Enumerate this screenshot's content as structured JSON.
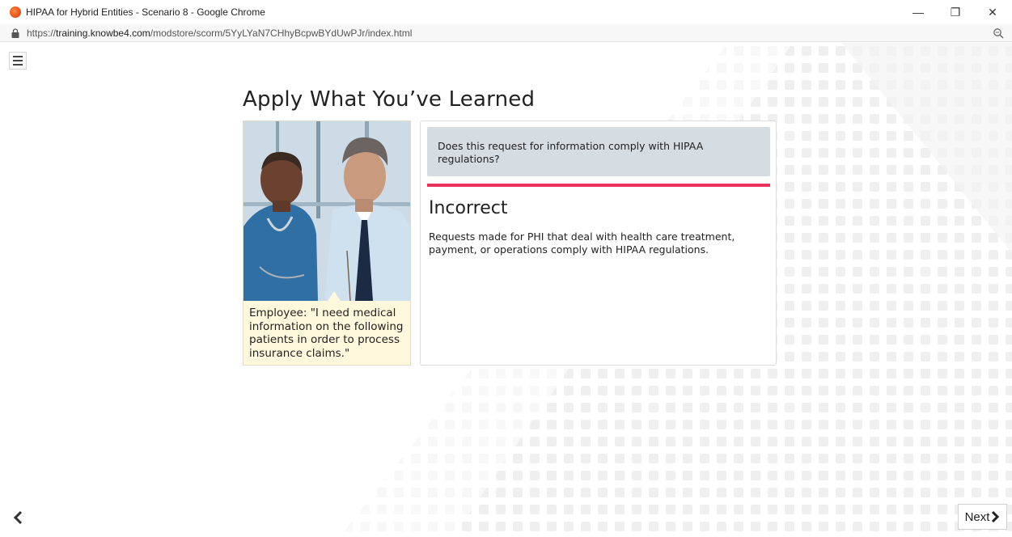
{
  "window": {
    "title": "HIPAA for Hybrid Entities - Scenario 8 - Google Chrome",
    "controls": {
      "minimize": "—",
      "maximize": "❐",
      "close": "✕"
    }
  },
  "address_bar": {
    "url_prefix": "https://",
    "url_host": "training.knowbe4.com",
    "url_path": "/modstore/scorm/5YyLYaN7CHhyBcpwBYdUwPJr/index.html"
  },
  "page": {
    "title": "Apply What You’ve Learned",
    "scene": {
      "caption": "Employee: \"I need medical information on the following patients in order to process insurance claims.\""
    },
    "question": "Does this request for information comply with HIPAA regulations?",
    "result": {
      "heading": "Incorrect",
      "body": "Requests made for PHI that deal with health care treatment, payment, or operations comply with HIPAA regulations.",
      "accent_color": "#e8325a"
    },
    "nav": {
      "next_label": "Next"
    }
  },
  "icons": {
    "app": "chrome-app-icon",
    "lock": "lock-icon",
    "zoom": "zoom-icon",
    "menu": "hamburger-menu-icon",
    "prev": "chevron-left-icon",
    "next": "chevron-right-icon"
  }
}
